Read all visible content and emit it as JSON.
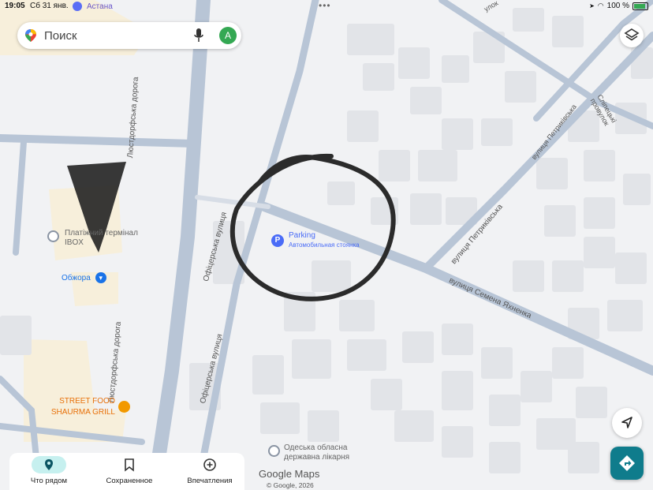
{
  "status": {
    "time": "19:05",
    "date": "Сб 31 янв.",
    "battery": "100 %",
    "dots": "•••"
  },
  "search": {
    "placeholder": "Поиск",
    "avatar_letter": "A"
  },
  "map": {
    "streets": {
      "lustdorf_1": "Люстдорфська дорога",
      "lustdorf_2": "Люстдорфська дорога",
      "ofitserska": "Офіцерська вулиця",
      "ofitserska_2": "Офіцерська вулиця",
      "semena": "вулиця Семена Яхненка",
      "petrykivska": "вулиця Петриківська",
      "petrykivska_2": "вулиця Петриківська",
      "sliptsi": "Сліпецькі провулок",
      "astana": "Астана",
      "top_lane": "улок"
    },
    "pois": {
      "parking_title": "Parking",
      "parking_sub": "Автомобильная стоянка",
      "terminal": "Платіжний термінал IBOX",
      "obzhora": "Обжора",
      "street_food": "STREET FOOD SHAURMA GRILL",
      "hospital_1": "Одеська обласна",
      "hospital_2": "державна лікарня"
    },
    "colors": {
      "road": "#b8c5d6",
      "building": "#e2e4e8",
      "yellow_area": "#f7efdb",
      "accent": "#0f7c8c",
      "parking": "#4a6cf7"
    }
  },
  "nav": {
    "items": [
      {
        "label": "Что рядом",
        "icon": "location-pin-icon",
        "active": true
      },
      {
        "label": "Сохраненное",
        "icon": "bookmark-icon",
        "active": false
      },
      {
        "label": "Впечатления",
        "icon": "plus-circle-icon",
        "active": false
      }
    ]
  },
  "attribution": {
    "logo": "Google Maps",
    "copyright": "© Google, 2026"
  }
}
